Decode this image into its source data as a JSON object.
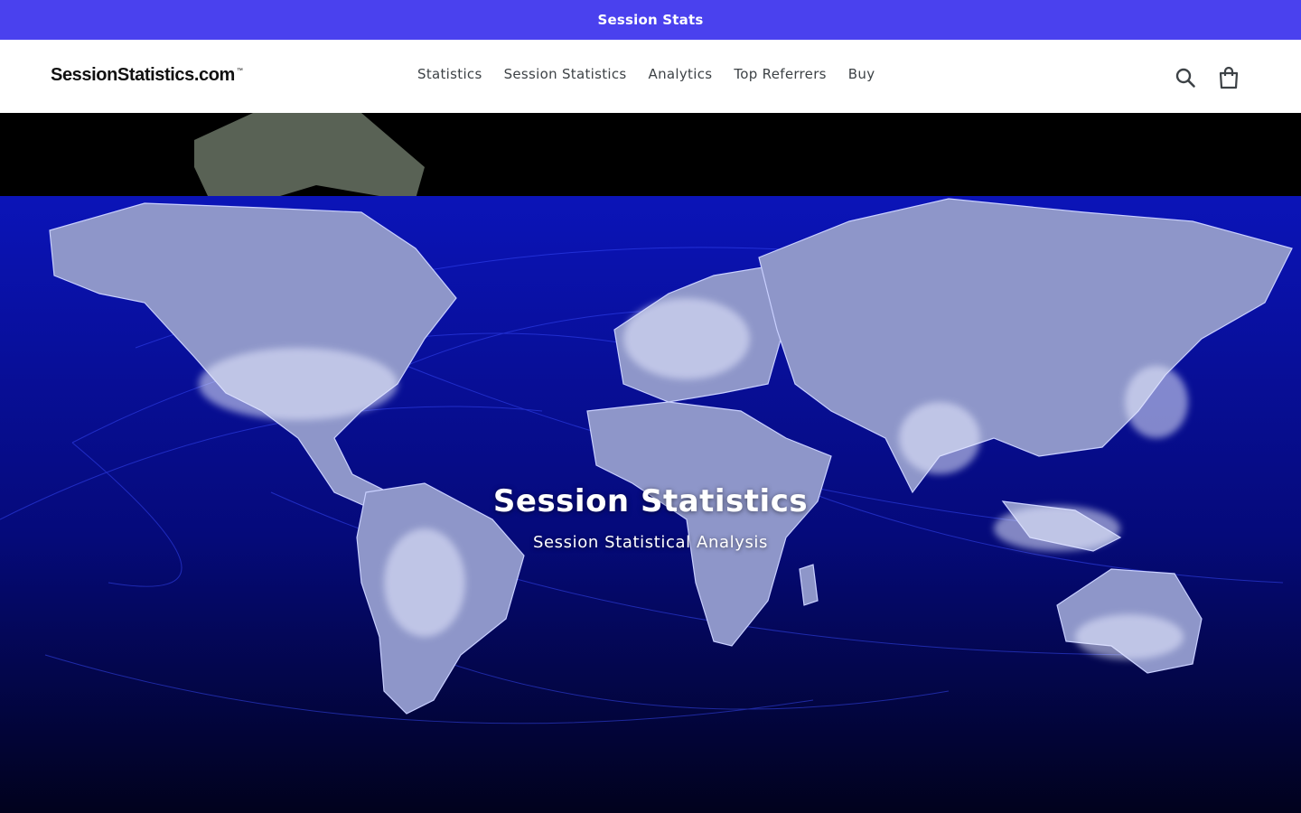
{
  "announcement": {
    "text": "Session Stats",
    "color": "#4a41ee"
  },
  "header": {
    "logo_text": "SessionStatistics.com",
    "logo_mark": "™",
    "nav": [
      {
        "label": "Statistics"
      },
      {
        "label": "Session Statistics"
      },
      {
        "label": "Analytics"
      },
      {
        "label": "Top Referrers"
      },
      {
        "label": "Buy"
      }
    ],
    "icons": {
      "search": "search-icon",
      "cart": "cart-icon"
    }
  },
  "hero": {
    "title": "Session Statistics",
    "subtitle": "Session Statistical Analysis",
    "image": "world-map-network-connections"
  }
}
